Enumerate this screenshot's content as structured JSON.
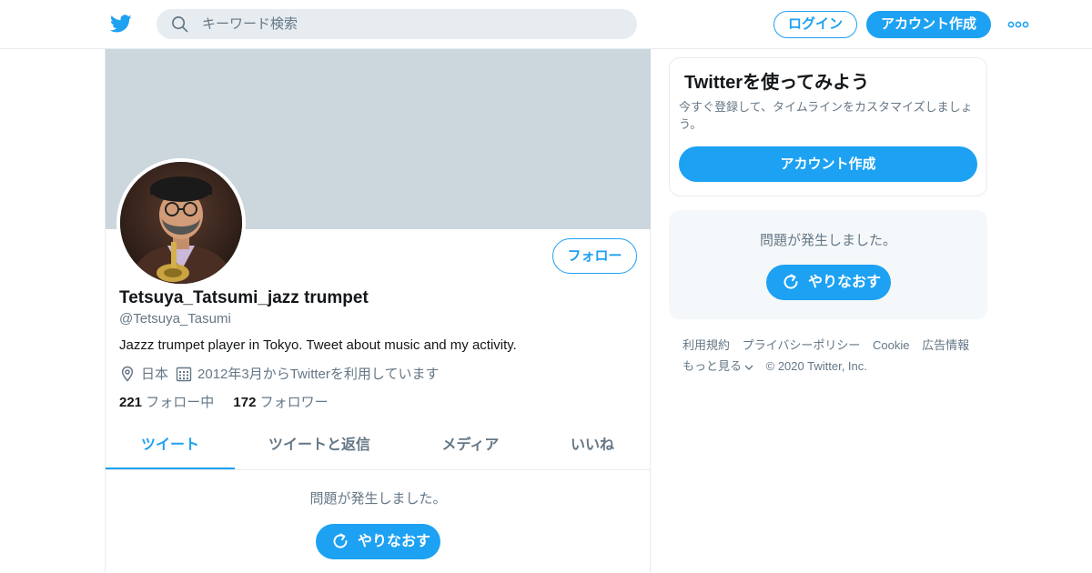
{
  "header": {
    "search_placeholder": "キーワード検索",
    "login_label": "ログイン",
    "signup_label": "アカウント作成"
  },
  "profile": {
    "follow_label": "フォロー",
    "display_name": "Tetsuya_Tatsumi_jazz trumpet",
    "handle": "@Tetsuya_Tasumi",
    "bio": "Jazzz trumpet player in Tokyo. Tweet about music and my activity.",
    "location": "日本",
    "joined": "2012年3月からTwitterを利用しています",
    "following_count": "221",
    "following_label": "フォロー中",
    "followers_count": "172",
    "followers_label": "フォロワー"
  },
  "tabs": [
    {
      "label": "ツイート",
      "active": true
    },
    {
      "label": "ツイートと返信",
      "active": false
    },
    {
      "label": "メディア",
      "active": false
    },
    {
      "label": "いいね",
      "active": false
    }
  ],
  "timeline_error": {
    "message": "問題が発生しました。",
    "retry_label": "やりなおす"
  },
  "sidebar": {
    "card_title": "Twitterを使ってみよう",
    "card_desc": "今すぐ登録して、タイムラインをカスタマイズしましょう。",
    "card_signup_label": "アカウント作成",
    "error_message": "問題が発生しました。",
    "retry_label": "やりなおす"
  },
  "footer": {
    "links": [
      "利用規約",
      "プライバシーポリシー",
      "Cookie",
      "広告情報"
    ],
    "more_label": "もっと見る",
    "copyright": "© 2020 Twitter, Inc."
  },
  "colors": {
    "accent": "#1da1f2",
    "banner": "#ccd6dd",
    "muted_text": "#657786"
  },
  "icons": [
    "twitter-bird-icon",
    "search-icon",
    "more-dots-icon",
    "location-icon",
    "calendar-icon",
    "retry-icon",
    "chevron-down-icon"
  ]
}
